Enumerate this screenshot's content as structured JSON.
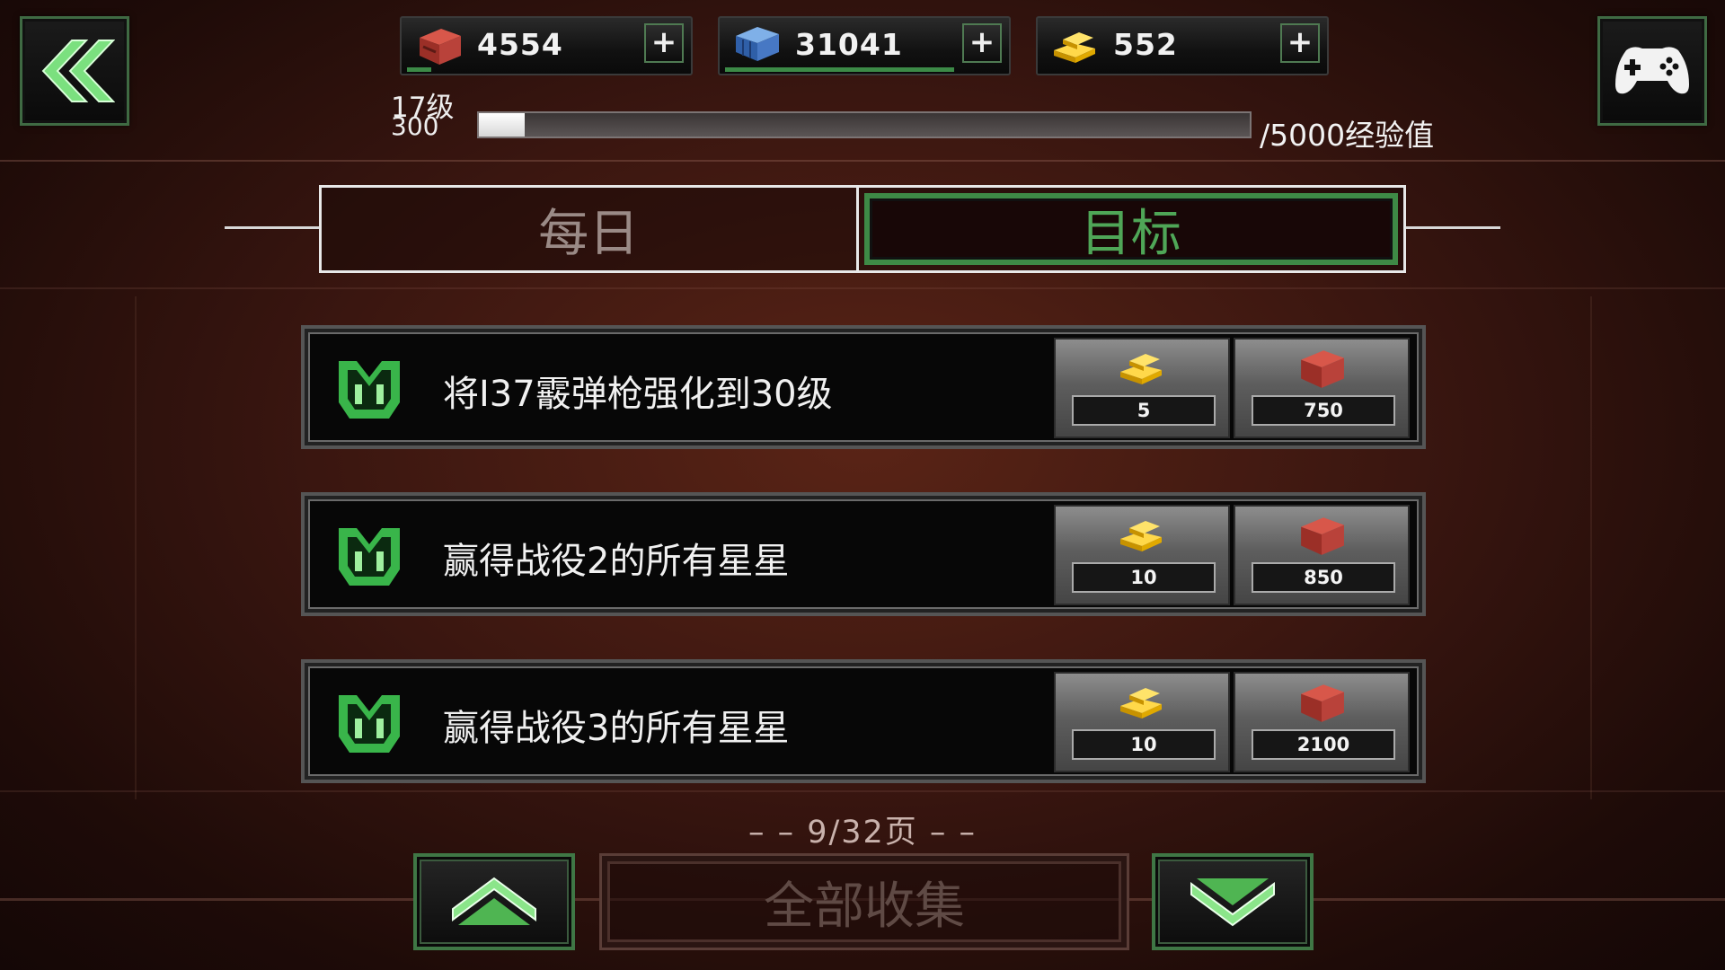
{
  "resources": [
    {
      "name": "red-crate",
      "value": "4554",
      "plus": "+",
      "bar_fraction": 0.12
    },
    {
      "name": "blue-crate",
      "value": "31041",
      "plus": "+",
      "bar_fraction": 0.83
    },
    {
      "name": "gold-bars",
      "value": "552",
      "plus": "+",
      "bar_fraction": 0
    }
  ],
  "level": {
    "label": "17级",
    "xp": "300",
    "xp_max_label": "/5000经验值",
    "progress_fraction": 0.06
  },
  "tabs": {
    "daily": "每日",
    "goals": "目标",
    "active": "goals"
  },
  "missions": [
    {
      "text": "将I37霰弹枪强化到30级",
      "gold": "5",
      "crates": "750"
    },
    {
      "text": "赢得战役2的所有星星",
      "gold": "10",
      "crates": "850"
    },
    {
      "text": "赢得战役3的所有星星",
      "gold": "10",
      "crates": "2100"
    }
  ],
  "pager": {
    "label": "– – 9/32页 – –"
  },
  "collect_all": "全部收集",
  "colors": {
    "accent_green": "#4fa657",
    "background": "#3a1610"
  },
  "icons": [
    "back-chevron-icon",
    "gamepad-icon",
    "red-crate-icon",
    "blue-crate-icon",
    "gold-bars-icon",
    "mission-emblem-icon",
    "chevron-up-icon",
    "chevron-down-icon"
  ]
}
